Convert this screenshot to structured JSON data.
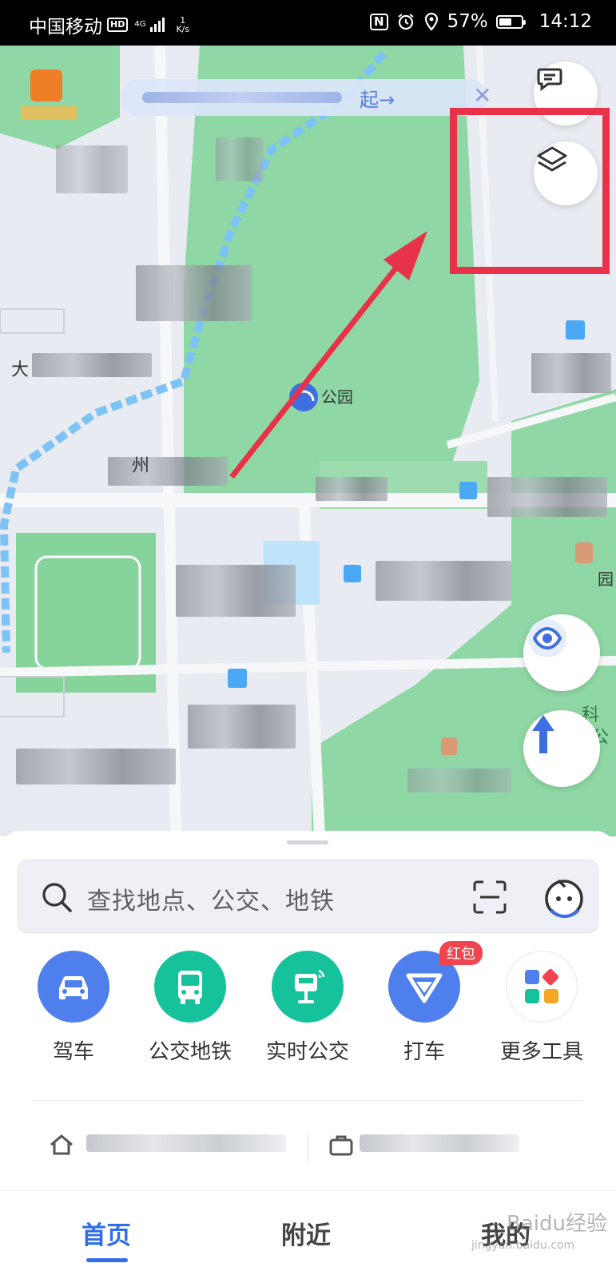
{
  "status_bar": {
    "carrier": "中国移动",
    "hd": "HD",
    "network": "4G",
    "speed_top": "1",
    "speed_bottom": "K/s",
    "nfc": "N",
    "battery_percent": "57%",
    "battery_level": 0.57,
    "time": "14:12"
  },
  "map": {
    "notice_cta": "起→",
    "notice_close": "✕",
    "labels": {
      "left_partial": "大",
      "center_partial": "州",
      "right_edge_1": "园",
      "right_edge_2": "科学",
      "right_edge_3": "公",
      "poi_partial": "公园"
    }
  },
  "search": {
    "placeholder": "查找地点、公交、地铁"
  },
  "tools": [
    {
      "label": "驾车",
      "color": "#4e7fec",
      "icon": "car-icon"
    },
    {
      "label": "公交地铁",
      "color": "#16c29c",
      "icon": "bus-icon"
    },
    {
      "label": "实时公交",
      "color": "#16c29c",
      "icon": "bus-stop-icon"
    },
    {
      "label": "打车",
      "color": "#4e7fec",
      "icon": "taxi-icon",
      "badge": "红包"
    },
    {
      "label": "更多工具",
      "color": "#ffffff",
      "icon": "apps-icon"
    }
  ],
  "tabs": [
    {
      "label": "首页",
      "active": true
    },
    {
      "label": "附近",
      "active": false
    },
    {
      "label": "我的",
      "active": false
    }
  ],
  "watermark": {
    "line1": "Baidu经验",
    "line2": "jingyan.baidu.com"
  },
  "colors": {
    "accent": "#2f6ee8",
    "highlight_box": "#e8324a",
    "park_green": "#8fd8a5",
    "water_blue": "#7ec3f5"
  }
}
